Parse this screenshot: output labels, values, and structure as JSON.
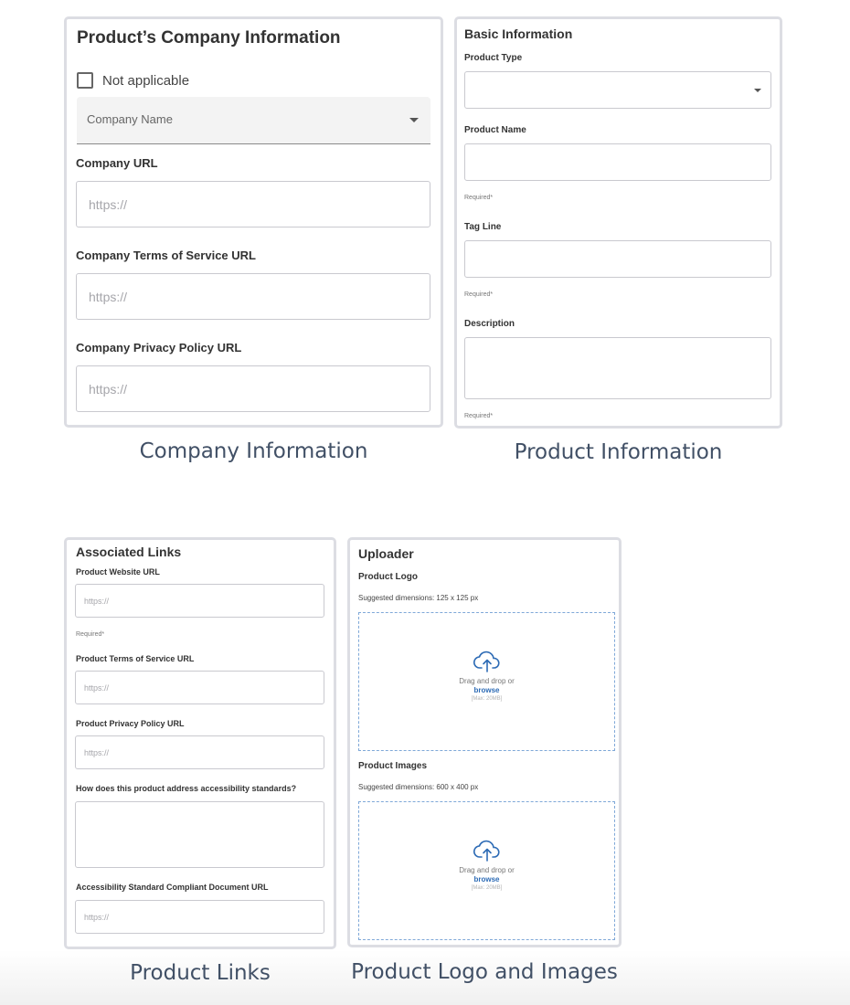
{
  "company_panel": {
    "title": "Product’s Company Information",
    "not_applicable_label": "Not applicable",
    "company_name_placeholder": "Company Name",
    "company_url_label": "Company URL",
    "company_url_placeholder": "https://",
    "tos_label": "Company Terms of Service URL",
    "tos_placeholder": "https://",
    "privacy_label": "Company Privacy Policy URL",
    "privacy_placeholder": "https://",
    "caption": "Company Information"
  },
  "product_panel": {
    "title": "Basic Information",
    "type_label": "Product Type",
    "type_value": "",
    "name_label": "Product Name",
    "name_hint": "Required*",
    "tagline_label": "Tag Line",
    "tagline_hint": "Required*",
    "description_label": "Description",
    "description_hint": "Required*",
    "caption": "Product Information"
  },
  "links_panel": {
    "title": "Associated Links",
    "website_label": "Product Website URL",
    "website_placeholder": "https://",
    "website_hint": "Required*",
    "tos_label": "Product Terms of Service URL",
    "tos_placeholder": "https://",
    "privacy_label": "Product Privacy Policy URL",
    "privacy_placeholder": "https://",
    "accessibility_label": "How does this product address accessibility standards?",
    "doc_label": "Accessibility Standard Compliant Document URL",
    "doc_placeholder": "https://",
    "caption": "Product Links"
  },
  "uploader_panel": {
    "title": "Uploader",
    "logo_label": "Product Logo",
    "logo_dims": "Suggested dimensions: 125 x 125 px",
    "images_label": "Product Images",
    "images_dims": "Suggested dimensions: 600 x 400 px",
    "drop_text": "Drag and drop or",
    "browse_text": "browse",
    "max_text": "[Max: 20MB]",
    "caption": "Product Logo and Images"
  },
  "colors": {
    "panel_border": "#dcdde3",
    "caption_text": "#415066",
    "link_blue": "#2d6bb5",
    "dashed_border": "#7fa8d8"
  },
  "icons": [
    "checkbox-icon",
    "caret-down-icon",
    "cloud-upload-icon"
  ]
}
